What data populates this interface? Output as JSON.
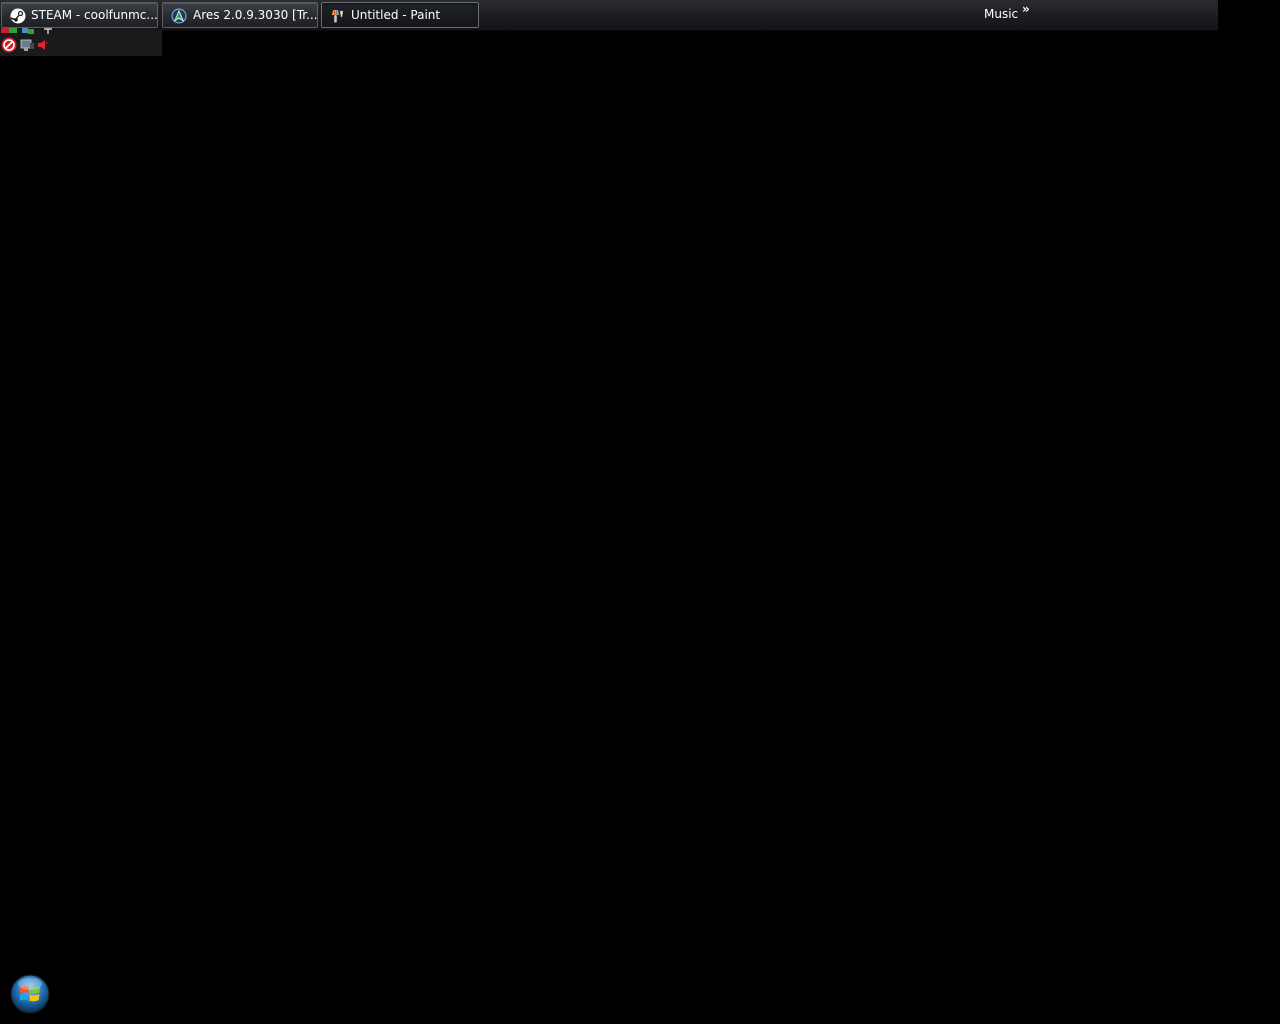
{
  "taskbar": {
    "buttons": [
      {
        "label": "STEAM - coolfunmc...",
        "icon": "steam-icon",
        "active": false
      },
      {
        "label": "Ares 2.0.9.3030   [Tr...",
        "icon": "ares-icon",
        "active": false
      },
      {
        "label": "Untitled - Paint",
        "icon": "paint-icon",
        "active": true
      }
    ],
    "toolbar_label": "Music",
    "toolbar_overflow": "»"
  },
  "tray": {
    "icons": [
      "red-flag-icon",
      "network-icon",
      "power-icon",
      "no-entry-icon",
      "monitor-icon",
      "volume-icon"
    ]
  },
  "start": {
    "icon": "windows-start-orb-icon"
  },
  "colors": {
    "desktop": "#000000",
    "taskbar": "#1b1c1f",
    "text": "#ffffff"
  }
}
